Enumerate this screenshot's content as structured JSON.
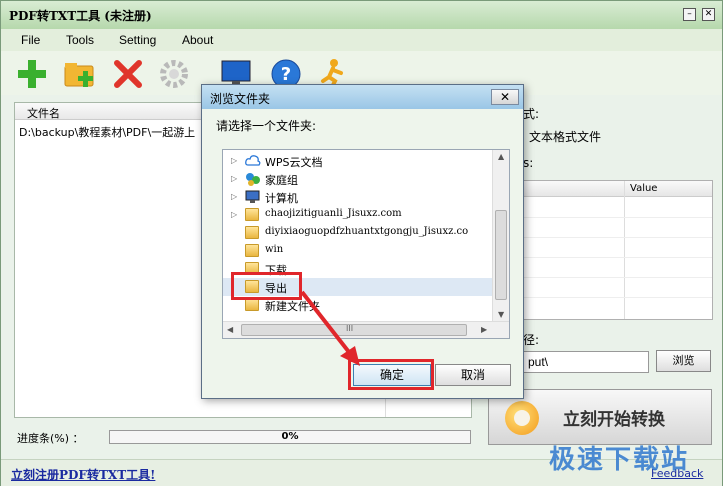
{
  "window": {
    "title": "PDF转TXT工具 (未注册)",
    "minimize_glyph": "–",
    "close_glyph": "✕"
  },
  "menu": [
    "File",
    "Tools",
    "Setting",
    "About"
  ],
  "toolbar": {
    "icons": [
      "add-file-icon",
      "add-folder-icon",
      "delete-icon",
      "settings-gear-icon",
      "monitor-icon",
      "help-icon",
      "runner-icon"
    ]
  },
  "file_list": {
    "header": "文件名",
    "rows": [
      "D:\\backup\\教程素材\\PDF\\一起游上"
    ]
  },
  "progress": {
    "label": "进度条(%) ：",
    "value_text": "0%"
  },
  "right_panel": {
    "label_format": "式:",
    "label_text_format": "文本格式文件",
    "label_properties": "s:",
    "table_value_header": "Value",
    "label_output": "径:",
    "output_value": "put\\",
    "browse_label": "浏览",
    "start_label": "立刻开始转换"
  },
  "statusbar": {
    "register_link": "立刻注册PDF转TXT工具!",
    "feedback_link": "Feedback"
  },
  "watermark": "极速下载站",
  "dialog": {
    "title": "浏览文件夹",
    "close_glyph": "✕",
    "prompt": "请选择一个文件夹:",
    "tree": [
      {
        "label": "WPS云文档",
        "icon": "cloud-icon",
        "expander": true
      },
      {
        "label": "家庭组",
        "icon": "homegroup-icon",
        "expander": true
      },
      {
        "label": "计算机",
        "icon": "computer-icon",
        "expander": true
      },
      {
        "label": "chaojizitiguanli_Jisuxz.com",
        "icon": "folder-icon",
        "expander": true
      },
      {
        "label": "diyixiaoguopdfzhuantxtgongju_Jisuxz.co",
        "icon": "folder-icon",
        "expander": false
      },
      {
        "label": "win",
        "icon": "folder-icon",
        "expander": false
      },
      {
        "label": "下载",
        "icon": "folder-icon",
        "expander": false
      },
      {
        "label": "导出",
        "icon": "folder-icon",
        "expander": false,
        "selected": true
      },
      {
        "label": "新建文件夹",
        "icon": "folder-icon",
        "expander": false
      }
    ],
    "scroll_label": "III",
    "ok_label": "确定",
    "cancel_label": "取消"
  },
  "colors": {
    "highlight": "#e0262b",
    "link": "#1a2aa0",
    "watermark": "#3a7fd0"
  }
}
